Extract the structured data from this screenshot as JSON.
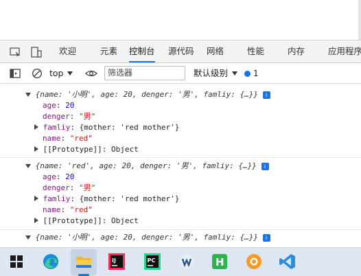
{
  "devtools": {
    "tabs": [
      {
        "label": "欢迎"
      },
      {
        "label": "元素"
      },
      {
        "label": "控制台"
      },
      {
        "label": "源代码"
      },
      {
        "label": "网络"
      },
      {
        "label": "性能"
      },
      {
        "label": "内存"
      },
      {
        "label": "应用程序"
      }
    ],
    "active_tab": "控制台",
    "accent": "#1a73e8"
  },
  "console_toolbar": {
    "context": "top",
    "filter_placeholder": "筛选器",
    "log_level": "默认级别",
    "issues_count": "1"
  },
  "console": {
    "entries": [
      {
        "summary": "{name: '小明', age: 20, denger: '男', famliy: {…}}",
        "expanded": true,
        "props": [
          {
            "key": "age",
            "sep": ": ",
            "value": "20",
            "kind": "num"
          },
          {
            "key": "denger",
            "sep": ": ",
            "value": "\"男\"",
            "kind": "str"
          },
          {
            "key": "famliy",
            "sep": ": ",
            "value": "{mother: 'red mother'}",
            "kind": "obj"
          },
          {
            "key": "name",
            "sep": ": ",
            "value": "\"red\"",
            "kind": "str"
          },
          {
            "key": "[[Prototype]]",
            "sep": ": ",
            "value": "Object",
            "kind": "plain"
          }
        ]
      },
      {
        "summary": "{name: 'red', age: 20, denger: '男', famliy: {…}}",
        "expanded": true,
        "props": [
          {
            "key": "age",
            "sep": ": ",
            "value": "20",
            "kind": "num"
          },
          {
            "key": "denger",
            "sep": ": ",
            "value": "\"男\"",
            "kind": "str"
          },
          {
            "key": "famliy",
            "sep": ": ",
            "value": "{mother: 'red mother'}",
            "kind": "obj"
          },
          {
            "key": "name",
            "sep": ": ",
            "value": "\"red\"",
            "kind": "str"
          },
          {
            "key": "[[Prototype]]",
            "sep": ": ",
            "value": "Object",
            "kind": "plain"
          }
        ]
      },
      {
        "summary": "{name: '小明', age: 20, denger: '男', famliy: {…}}",
        "expanded": true,
        "props": []
      }
    ],
    "info_badge": "i"
  },
  "taskbar": {
    "apps": [
      {
        "icon": "windows-start-icon"
      },
      {
        "icon": "edge-browser-icon"
      },
      {
        "icon": "file-explorer-icon"
      },
      {
        "icon": "intellij-idea-icon"
      },
      {
        "icon": "pycharm-icon"
      },
      {
        "icon": "webstorm-icon"
      },
      {
        "icon": "hbuilder-icon"
      },
      {
        "icon": "orange-app-icon"
      },
      {
        "icon": "vscode-icon"
      }
    ],
    "idea_label": "IJ",
    "pycharm_label": "PC",
    "hbuilder_label": "H"
  }
}
